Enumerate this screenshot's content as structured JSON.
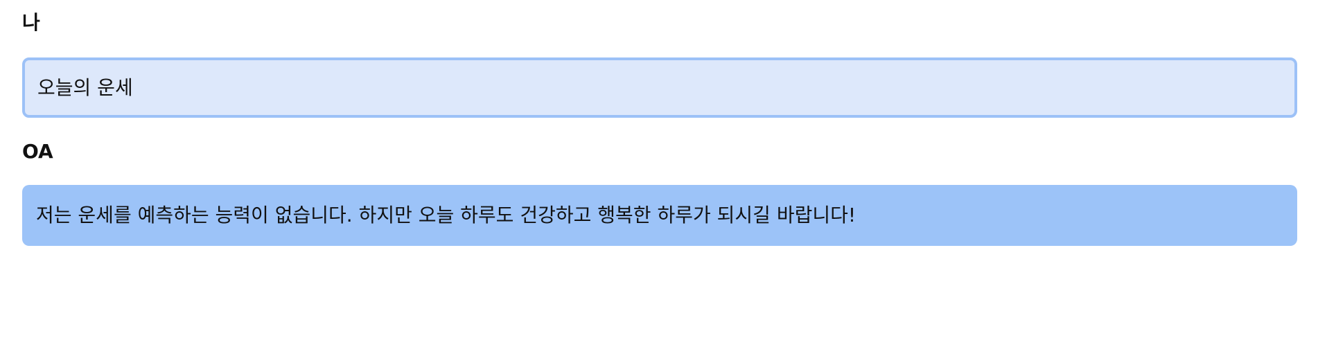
{
  "conversation": {
    "user": {
      "speaker": "나",
      "message": "오늘의 운세"
    },
    "assistant": {
      "speaker": "OA",
      "message": "저는 운세를 예측하는 능력이 없습니다. 하지만 오늘 하루도 건강하고 행복한 하루가 되시길 바랍니다!"
    }
  },
  "colors": {
    "user_bubble_bg": "#dde8fb",
    "user_bubble_border": "#9cc1f7",
    "assistant_bubble_bg": "#9cc3f8"
  }
}
